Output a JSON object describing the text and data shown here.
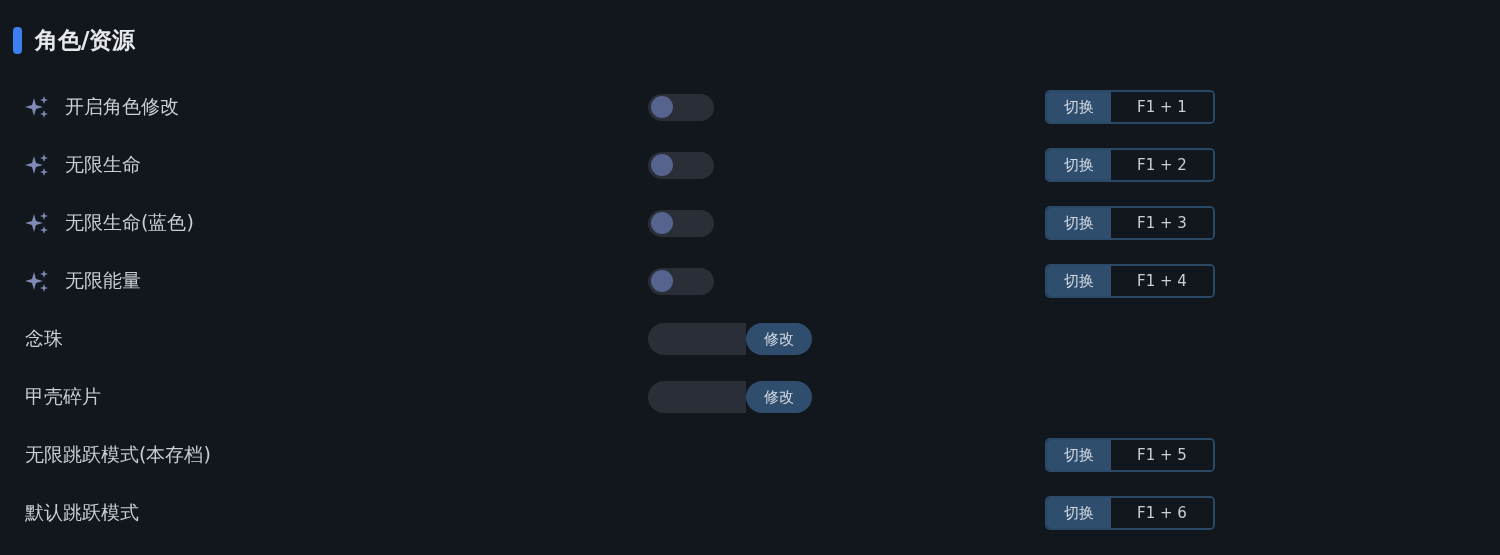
{
  "section": {
    "title": "角色/资源"
  },
  "rows": [
    {
      "kind": "toggle",
      "label": "开启角色修改",
      "on": false,
      "hotkey": {
        "action": "切换",
        "keys": "F1 + 1"
      }
    },
    {
      "kind": "toggle",
      "label": "无限生命",
      "on": false,
      "hotkey": {
        "action": "切换",
        "keys": "F1 + 2"
      }
    },
    {
      "kind": "toggle",
      "label": "无限生命(蓝色)",
      "on": false,
      "hotkey": {
        "action": "切换",
        "keys": "F1 + 3"
      }
    },
    {
      "kind": "toggle",
      "label": "无限能量",
      "on": false,
      "hotkey": {
        "action": "切换",
        "keys": "F1 + 4"
      }
    },
    {
      "kind": "input",
      "label": "念珠",
      "button": "修改"
    },
    {
      "kind": "input",
      "label": "甲壳碎片",
      "button": "修改"
    },
    {
      "kind": "action",
      "label": "无限跳跃模式(本存档)",
      "hotkey": {
        "action": "切换",
        "keys": "F1 + 5"
      }
    },
    {
      "kind": "action",
      "label": "默认跳跃模式",
      "hotkey": {
        "action": "切换",
        "keys": "F1 + 6"
      }
    }
  ]
}
